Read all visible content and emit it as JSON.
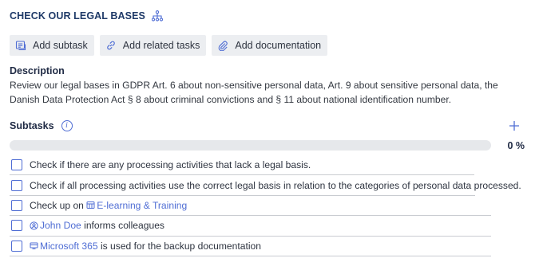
{
  "header": {
    "title": "CHECK OUR LEGAL BASES",
    "title_icon": "hierarchy-icon"
  },
  "actions": [
    {
      "label": "Add subtask",
      "icon": "subtask-icon"
    },
    {
      "label": "Add related tasks",
      "icon": "link-icon"
    },
    {
      "label": "Add documentation",
      "icon": "paperclip-icon"
    }
  ],
  "description": {
    "heading": "Description",
    "text": "Review our legal bases in GDPR Art. 6 about non-sensitive personal data, Art. 9 about sensitive personal data, the Danish Data Protection Act § 8 about criminal convictions and § 11 about national identification number."
  },
  "subtasks": {
    "heading": "Subtasks",
    "progress_label": "0 %",
    "progress_fraction": 0,
    "items": [
      {
        "text": "Check if there are any processing activities that lack a legal basis.",
        "checked": false
      },
      {
        "text": "Check if all processing activities use the correct legal basis in relation to the categories of personal data processed.",
        "checked": false
      },
      {
        "prefix": "Check up on ",
        "link": "E-learning & Training",
        "link_icon": "module-icon",
        "checked": false
      },
      {
        "link": "John Doe",
        "link_icon": "user-icon",
        "suffix": " informs colleagues",
        "checked": false
      },
      {
        "link": "Microsoft 365",
        "link_icon": "system-icon",
        "suffix": " is used for the backup documentation",
        "checked": false
      }
    ]
  },
  "colors": {
    "accent": "#4f6dd4",
    "title": "#1f3a68",
    "button_bg": "#eceef1",
    "progress_track": "#e6e8eb"
  }
}
